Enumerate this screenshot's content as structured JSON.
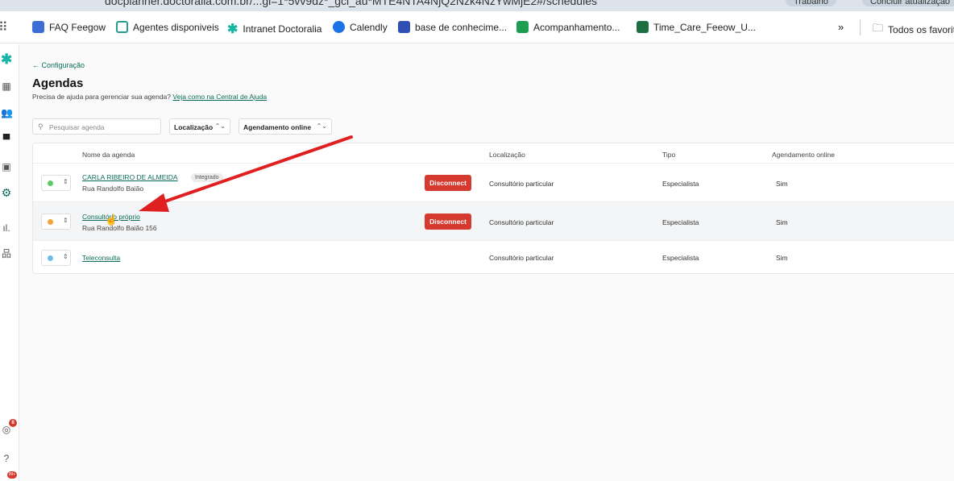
{
  "browser": {
    "url": "docplanner.doctoralia.com.br/...gl=1*5vv9dz*_gcl_au*MTE4NTA4NjQ2Nzk4NzYwMjE2#/schedules",
    "profile_label": "Trabalho",
    "update_label": "Concluir atualização"
  },
  "bookmarks": [
    {
      "label": "FAQ Feegow",
      "color": "#3b6fd6"
    },
    {
      "label": "Agentes disponiveis",
      "color": "#2a9d8f"
    },
    {
      "label": "Intranet Doctoralia",
      "color": "#17b3a3"
    },
    {
      "label": "Calendly",
      "color": "#1a73e8"
    },
    {
      "label": "base de conhecime...",
      "color": "#2f4fb5"
    },
    {
      "label": "Acompanhamento...",
      "color": "#1e9e52"
    },
    {
      "label": "Time_Care_Feeow_U...",
      "color": "#1d6f42"
    }
  ],
  "bookmarks_more": "»",
  "bookmarks_all": "Todos os favoritos",
  "sidebar": {
    "notification_count": "8",
    "bottom_badge": "99+"
  },
  "page": {
    "back_label": "← Configuração",
    "title": "Agendas",
    "help_text": "Precisa de ajuda para gerenciar sua agenda?",
    "help_link": "Veja como na Central de Ajuda",
    "search_placeholder": "Pesquisar agenda",
    "filter_location": "Localização",
    "filter_online": "Agendamento online"
  },
  "table": {
    "headers": {
      "name": "Nome da agenda",
      "location": "Localização",
      "type": "Tipo",
      "online": "Agendamento online"
    },
    "rows": [
      {
        "name": "CARLA RIBEIRO DE ALMEIDA",
        "address": "Rua Randolfo Baião",
        "badge": "Integrado",
        "action": "Disconnect",
        "location": "Consultório particular",
        "type": "Especialista",
        "online": "Sim",
        "dot_color": "#5cc96a"
      },
      {
        "name": "Consultório próprio",
        "address": "Rua Randolfo Baião 156",
        "badge": "",
        "action": "Disconnect",
        "location": "Consultório particular",
        "type": "Especialista",
        "online": "Sim",
        "dot_color": "#f0a33a"
      },
      {
        "name": "Teleconsulta",
        "address": "",
        "badge": "",
        "action": "",
        "location": "Consultório particular",
        "type": "Especialista",
        "online": "Sim",
        "dot_color": "#6bbfe8"
      }
    ]
  },
  "colors": {
    "accent": "#0a6d5a",
    "danger": "#d63a2f",
    "arrow": "#e02020"
  }
}
